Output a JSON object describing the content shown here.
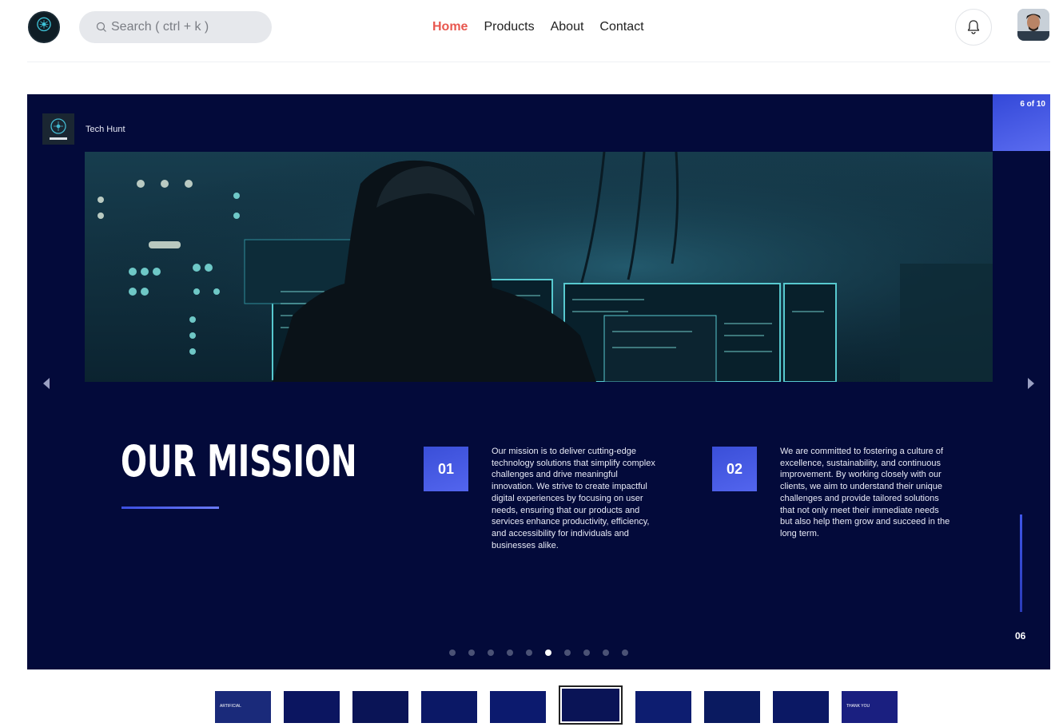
{
  "header": {
    "search_placeholder": "Search ( ctrl + k )",
    "nav": [
      {
        "label": "Home",
        "active": true
      },
      {
        "label": "Products",
        "active": false
      },
      {
        "label": "About",
        "active": false
      },
      {
        "label": "Contact",
        "active": false
      }
    ]
  },
  "slide": {
    "brand": "Tech Hunt",
    "counter": "6 of 10",
    "title": "OUR MISSION",
    "points": [
      {
        "number": "01",
        "text": "Our mission is to deliver cutting-edge technology solutions that simplify complex challenges and drive meaningful innovation. We strive to create impactful digital experiences by focusing on user needs, ensuring that our products and services enhance productivity, efficiency, and accessibility for individuals and businesses alike."
      },
      {
        "number": "02",
        "text": "We are committed to fostering a culture of excellence, sustainability, and continuous improvement. By working closely with our clients, we aim to understand their unique challenges and provide tailored solutions that not only meet their immediate needs but also help them grow and succeed in the long term."
      }
    ],
    "page_number": "06",
    "total_slides": 10,
    "current_slide": 6
  },
  "colors": {
    "accent": "#e8574f",
    "slide_background": "#030a3a",
    "slide_accent": "#4356e4"
  },
  "icons": {
    "search": "search-icon",
    "bell": "bell-icon",
    "prev": "chevron-left-icon",
    "next": "chevron-right-icon"
  },
  "thumbnails": [
    {
      "label": "ARTIFICIAL"
    },
    {
      "label": ""
    },
    {
      "label": ""
    },
    {
      "label": ""
    },
    {
      "label": ""
    },
    {
      "label": ""
    },
    {
      "label": ""
    },
    {
      "label": ""
    },
    {
      "label": ""
    },
    {
      "label": "THANK YOU"
    }
  ]
}
